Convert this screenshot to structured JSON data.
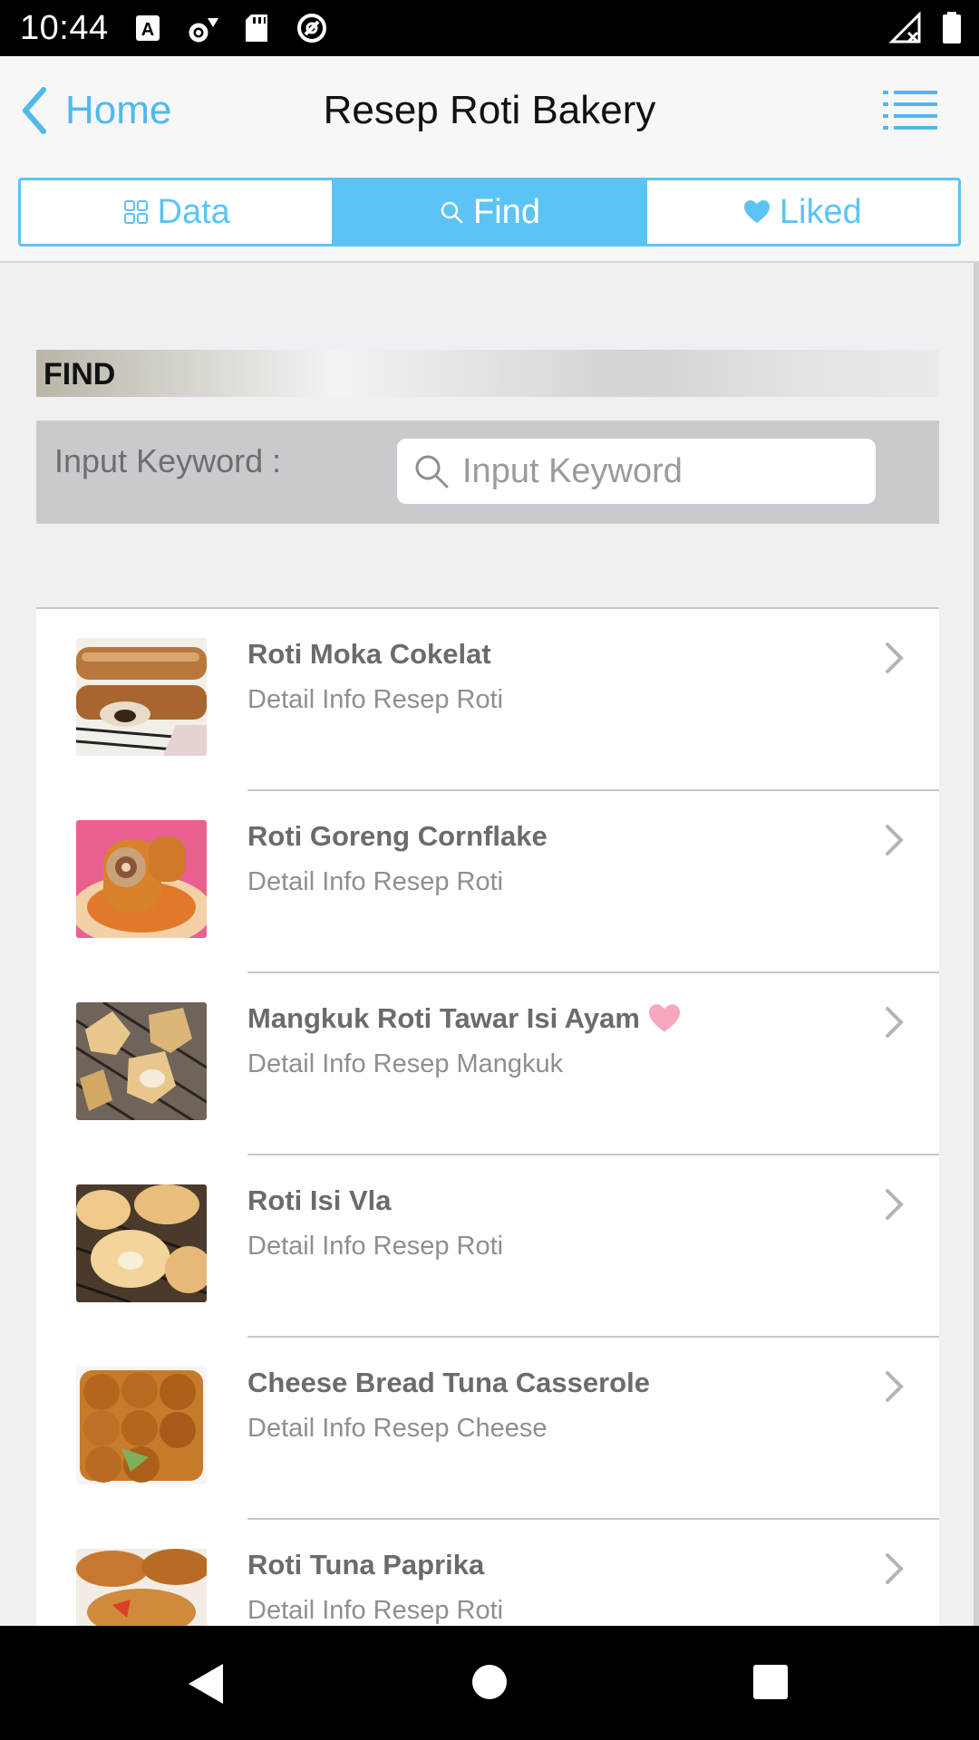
{
  "status_bar": {
    "time": "10:44",
    "icons": [
      "a-icon",
      "settings-wifi-icon",
      "sd-card-icon",
      "sync-icon"
    ],
    "right_icons": [
      "signal-icon",
      "battery-icon"
    ]
  },
  "nav": {
    "back_label": "Home",
    "title": "Resep Roti Bakery"
  },
  "tabs": [
    {
      "label": "Data",
      "icon": "grid-icon",
      "active": false
    },
    {
      "label": "Find",
      "icon": "search-icon",
      "active": true
    },
    {
      "label": "Liked",
      "icon": "heart-icon",
      "active": false
    }
  ],
  "find": {
    "header": "FIND",
    "input_label": "Input Keyword :",
    "input_placeholder": "Input Keyword",
    "input_value": ""
  },
  "items": [
    {
      "title": "Roti Moka Cokelat",
      "subtitle": "Detail Info Resep Roti",
      "liked": false
    },
    {
      "title": "Roti Goreng Cornflake",
      "subtitle": "Detail Info Resep Roti",
      "liked": false
    },
    {
      "title": "Mangkuk Roti Tawar Isi Ayam",
      "subtitle": "Detail Info Resep Mangkuk",
      "liked": true
    },
    {
      "title": "Roti Isi Vla",
      "subtitle": "Detail Info Resep Roti",
      "liked": false
    },
    {
      "title": "Cheese Bread Tuna Casserole",
      "subtitle": "Detail Info Resep Cheese",
      "liked": false
    },
    {
      "title": "Roti Tuna Paprika",
      "subtitle": "Detail Info Resep Roti",
      "liked": false
    }
  ],
  "colors": {
    "accent": "#5bc4f5",
    "back": "#4fb9ee",
    "liked_heart": "#f7a8bd"
  }
}
